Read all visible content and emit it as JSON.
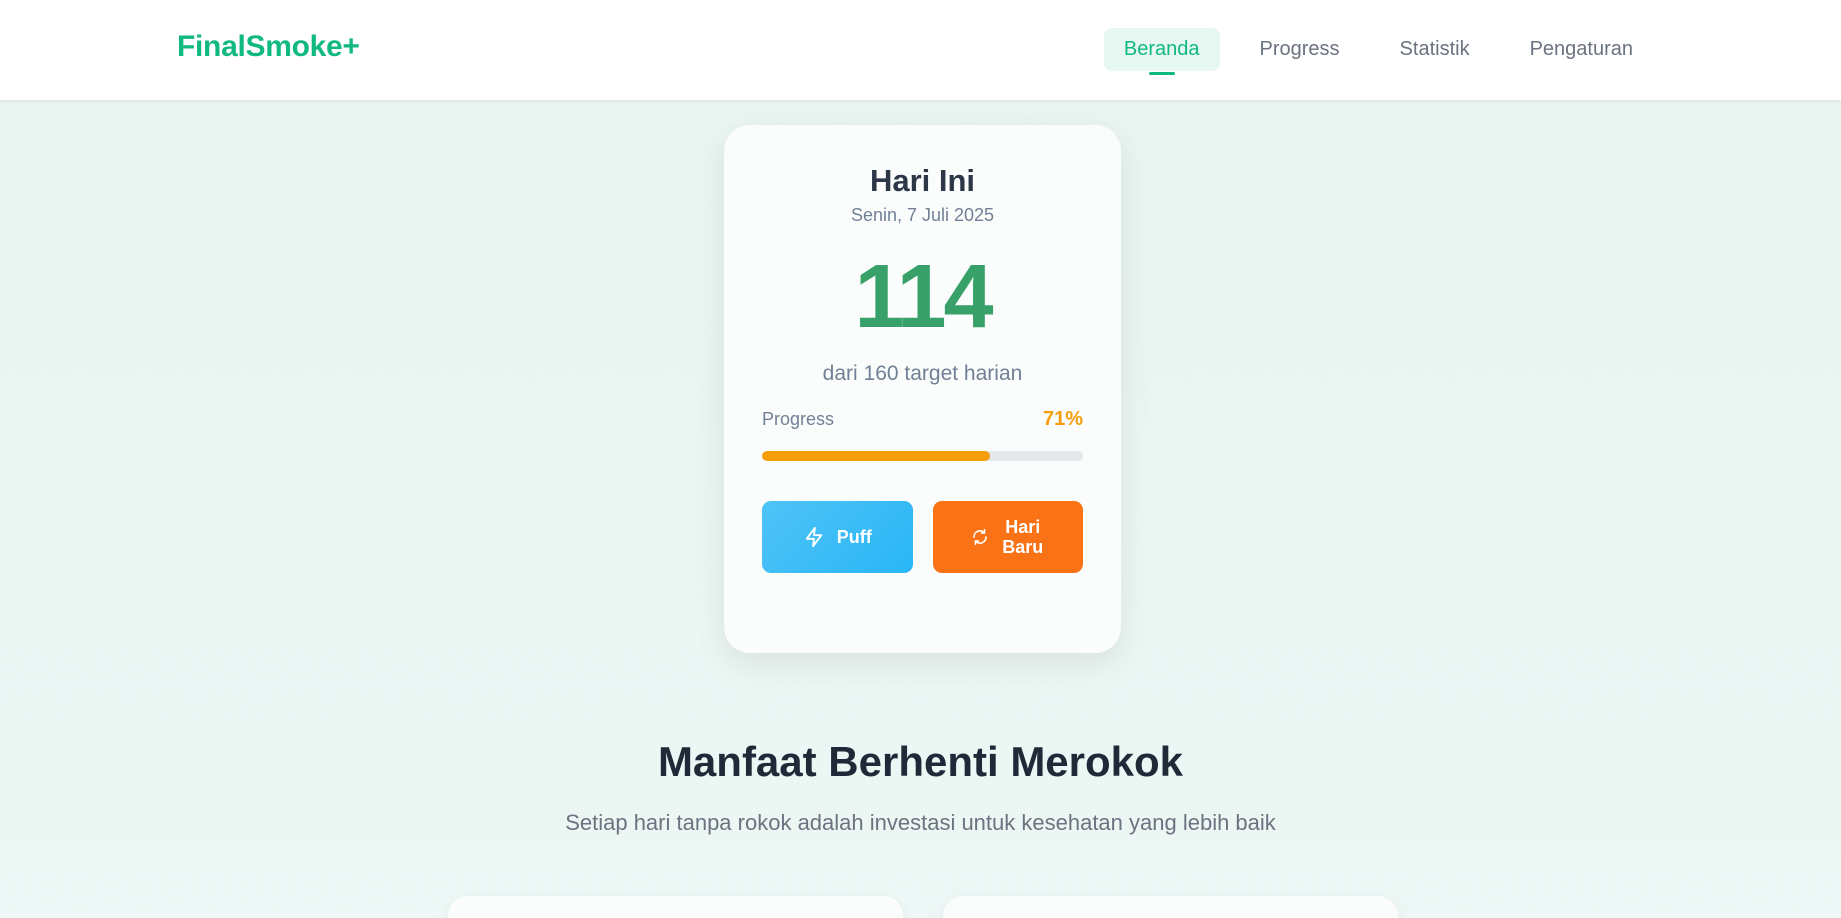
{
  "app": {
    "brand": "FinalSmoke+"
  },
  "nav": {
    "items": [
      {
        "label": "Beranda",
        "active": true
      },
      {
        "label": "Progress",
        "active": false
      },
      {
        "label": "Statistik",
        "active": false
      },
      {
        "label": "Pengaturan",
        "active": false
      }
    ]
  },
  "today": {
    "title": "Hari Ini",
    "date": "Senin, 7 Juli 2025",
    "count": "114",
    "target_text": "dari 160 target harian",
    "progress_label": "Progress",
    "progress_percent_text": "71%",
    "progress_value": 0.71
  },
  "actions": {
    "puff_label": "Puff",
    "puff_icon": "lightning-icon",
    "new_day_label": "Hari Baru",
    "new_day_icon": "refresh-icon"
  },
  "benefits": {
    "title": "Manfaat Berhenti Merokok",
    "subtitle": "Setiap hari tanpa rokok adalah investasi untuk kesehatan yang lebih baik"
  },
  "colors": {
    "brand": "#10b981",
    "count": "#38a169",
    "progress": "#f59e0b",
    "puff_button": "#29b6f6",
    "new_day_button": "#f97316"
  }
}
